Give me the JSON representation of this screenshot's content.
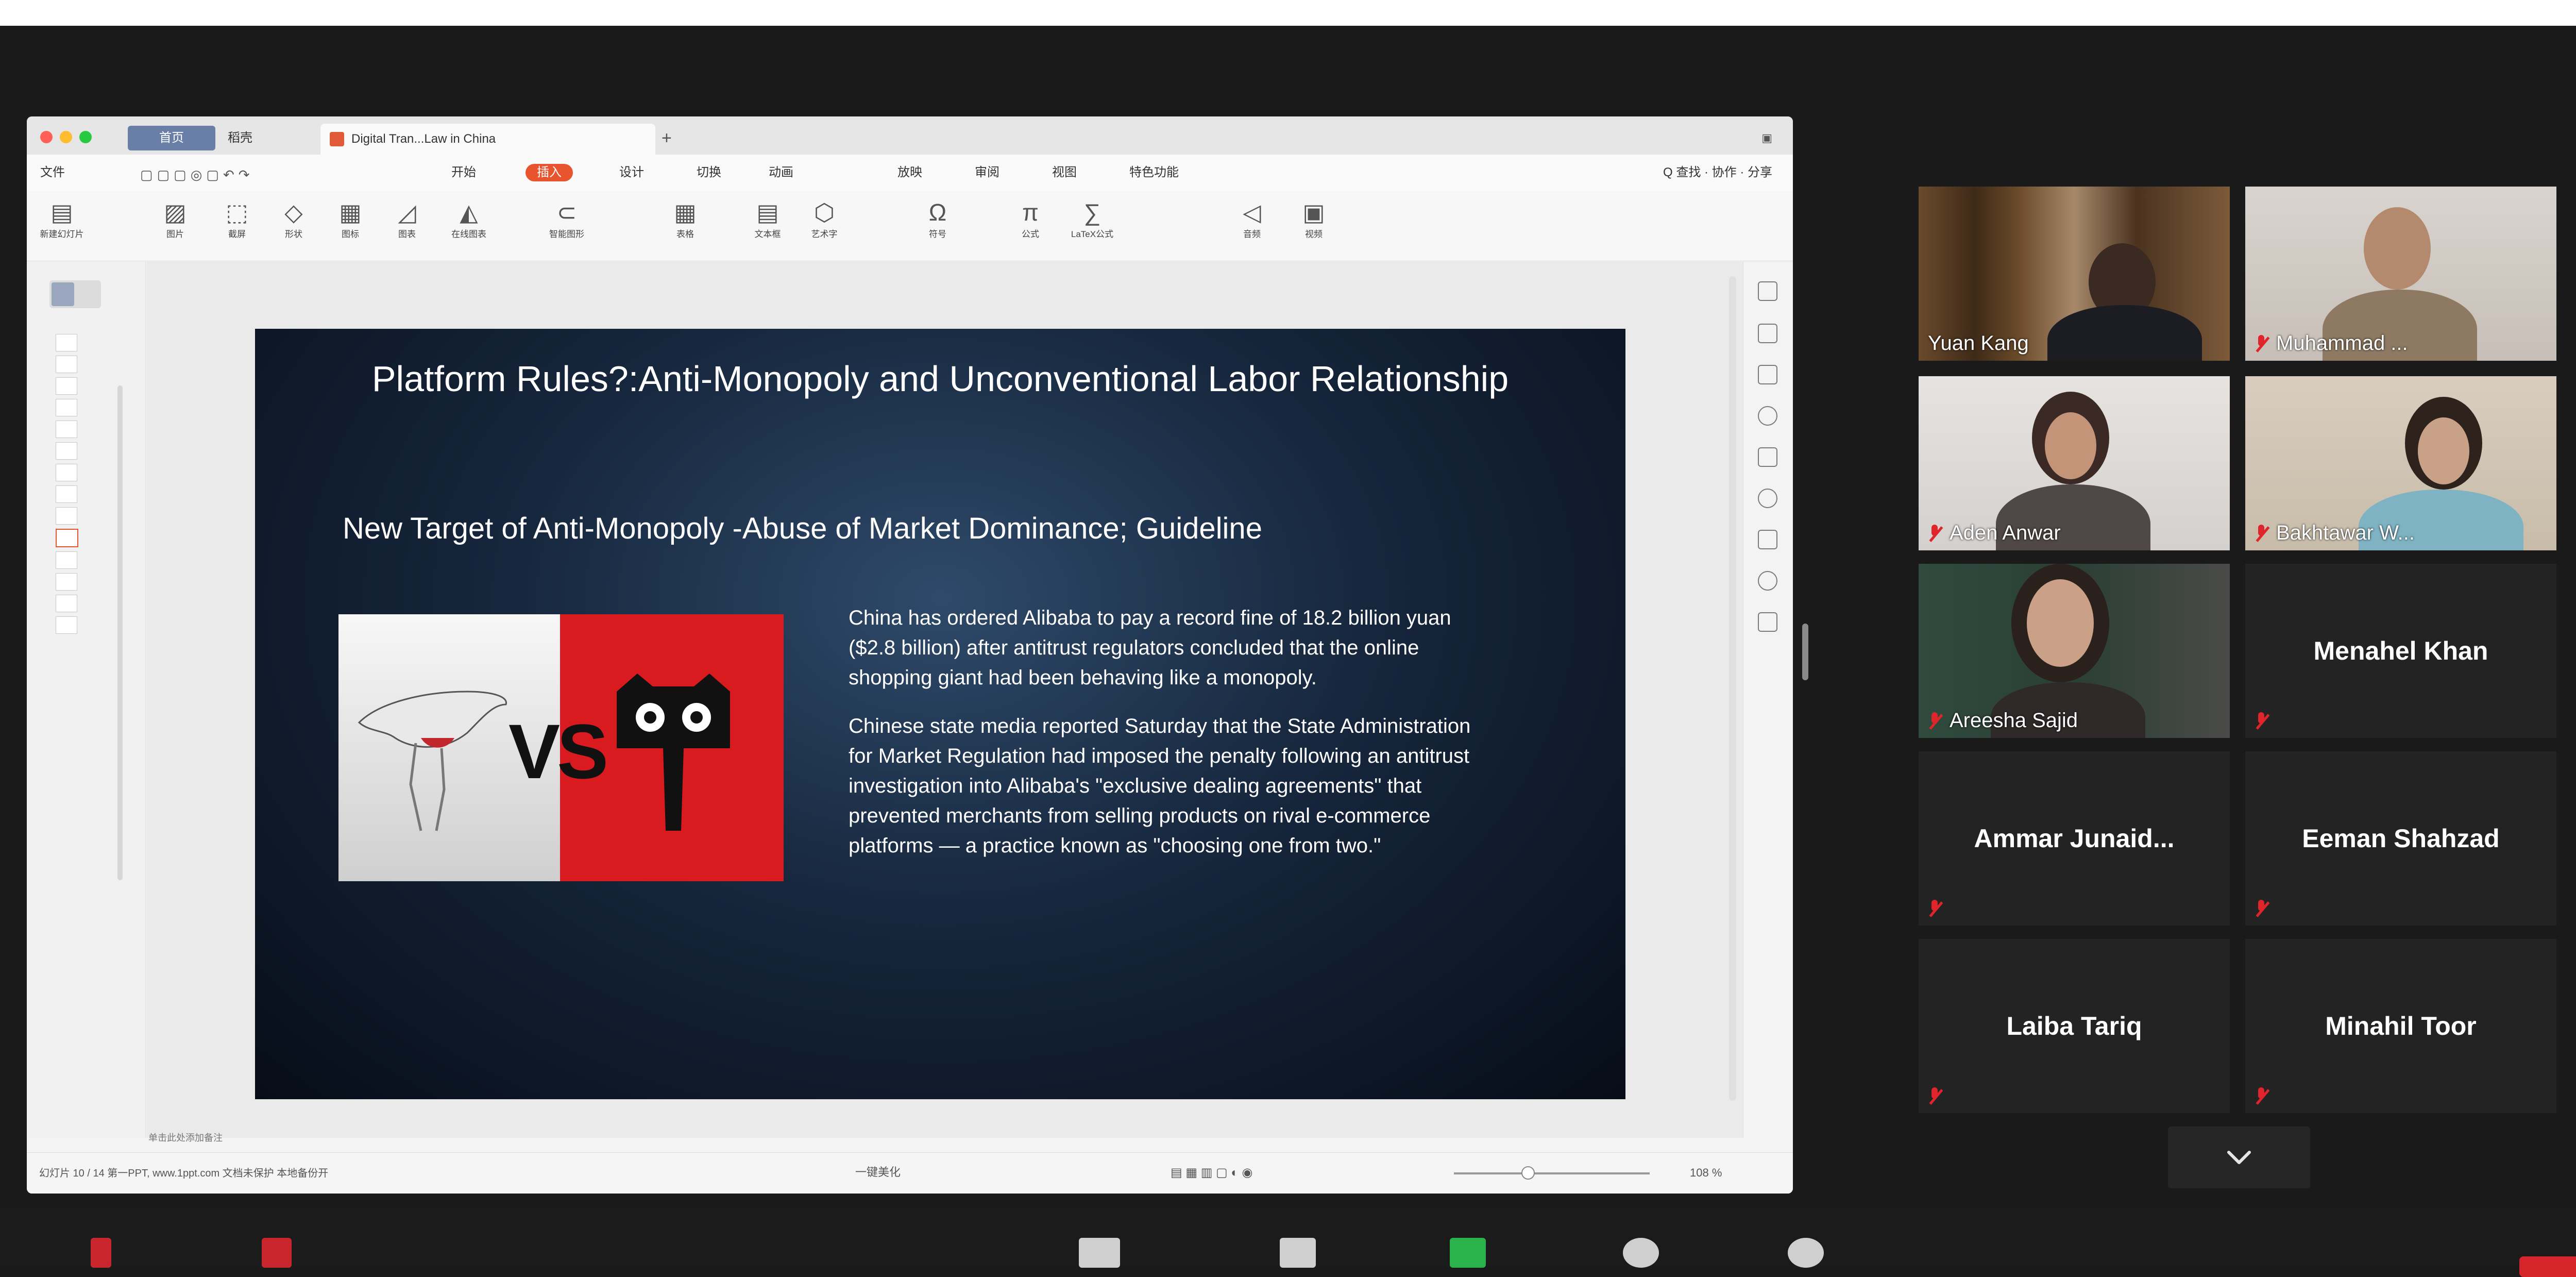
{
  "presentation_app": {
    "tabs": [
      "首页",
      "稻壳",
      "Digital Tran...Law in China"
    ],
    "menu": [
      "文件",
      "开始",
      "插入",
      "设计",
      "切换",
      "动画",
      "放映",
      "审阅",
      "视图",
      "特色功能"
    ],
    "active_menu": "插入",
    "menu_right": "Q 查找 · 协作 · 分享",
    "ribbon": [
      "新建幻灯片",
      "图片",
      "截屏",
      "形状",
      "图标",
      "图表",
      "在线图表",
      "智能图形",
      "表格",
      "文本框",
      "艺术字",
      "符号",
      "公式",
      "LaTeX公式",
      "音频",
      "视频"
    ],
    "status_left": "幻灯片 10 / 14    第一PPT, www.1ppt.com    文档未保护    本地备份开",
    "status_mid": "一键美化",
    "zoom": "108 %",
    "zoom_level": 0.38,
    "thumbnails_count": 14,
    "current_slide": 10,
    "slide_note": "单击此处添加备注"
  },
  "slide": {
    "title": "Platform Rules?:Anti-Monopoly and Unconventional Labor Relationship",
    "subtitle": "New Target of Anti-Monopoly -Abuse of Market Dominance; Guideline",
    "image_text": "VS",
    "paragraph_1": "China has ordered Alibaba to pay a record fine of 18.2 billion yuan ($2.8 billion) after antitrust regulators concluded that the online shopping giant had been behaving like a monopoly.",
    "paragraph_2": "Chinese state media reported Saturday that the State Administration for Market Regulation had imposed the penalty following an antitrust investigation into Alibaba's \"exclusive dealing agreements\" that prevented merchants from selling products on rival e-commerce platforms — a practice known as \"choosing one from two.\""
  },
  "participants": [
    {
      "name": "Yuan Kang",
      "video": true,
      "muted": false,
      "active_speaker": true
    },
    {
      "name": "Muhammad ...",
      "video": true,
      "muted": true
    },
    {
      "name": "Aden Anwar",
      "video": true,
      "muted": true
    },
    {
      "name": "Bakhtawar W...",
      "video": true,
      "muted": true
    },
    {
      "name": "Areesha Sajid",
      "video": true,
      "muted": true
    },
    {
      "name": "Menahel Khan",
      "video": false,
      "muted": true
    },
    {
      "name": "Ammar Junaid...",
      "video": false,
      "muted": true
    },
    {
      "name": "Eeman Shahzad",
      "video": false,
      "muted": true
    },
    {
      "name": "Laiba Tariq",
      "video": false,
      "muted": true
    },
    {
      "name": "Minahil Toor",
      "video": false,
      "muted": true
    }
  ],
  "gallery_nav_icon": "chevron-down-icon",
  "colors": {
    "active_speaker_border": "#d7e35a",
    "muted_icon": "#e0242b",
    "active_menu": "#e8542e",
    "slide_bg": "#16263c"
  }
}
